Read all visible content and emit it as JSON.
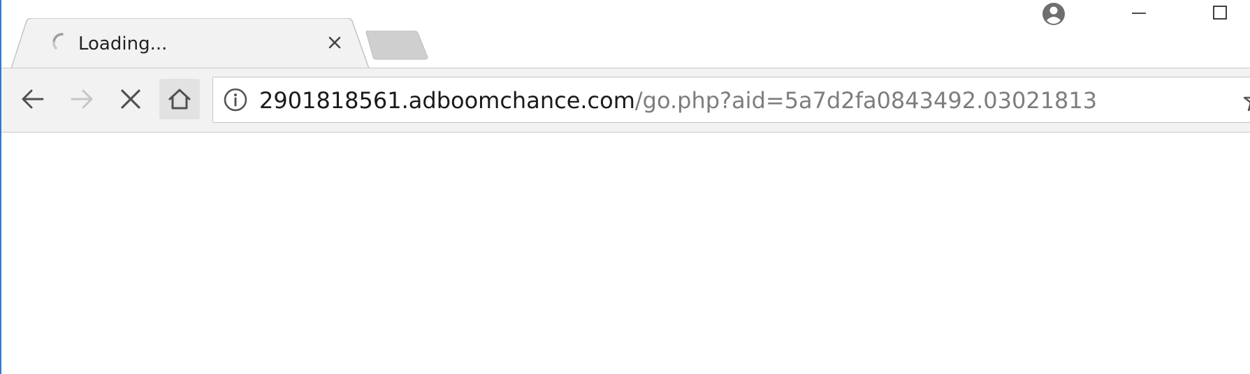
{
  "tab": {
    "title": "Loading...",
    "status": "loading"
  },
  "icons": {
    "spinner": "loading-spinner-icon",
    "close": "close-icon",
    "new_tab": "new-tab-icon",
    "profile": "profile-icon",
    "minimize": "minimize-icon",
    "maximize": "maximize-icon",
    "back": "arrow-left-icon",
    "forward": "arrow-right-icon",
    "stop": "x-stop-icon",
    "home": "home-icon",
    "site_info": "info-circle-icon",
    "bookmark": "star-icon"
  },
  "omnibox": {
    "host": "2901818561.adboomchance.com",
    "path": "/go.php?aid=5a7d2fa0843492.03021813"
  },
  "colors": {
    "window_border": "#2b7cd3",
    "toolbar_bg": "#f2f2f2",
    "url_host": "#1a1a1a",
    "url_path": "#7d7d7d"
  }
}
